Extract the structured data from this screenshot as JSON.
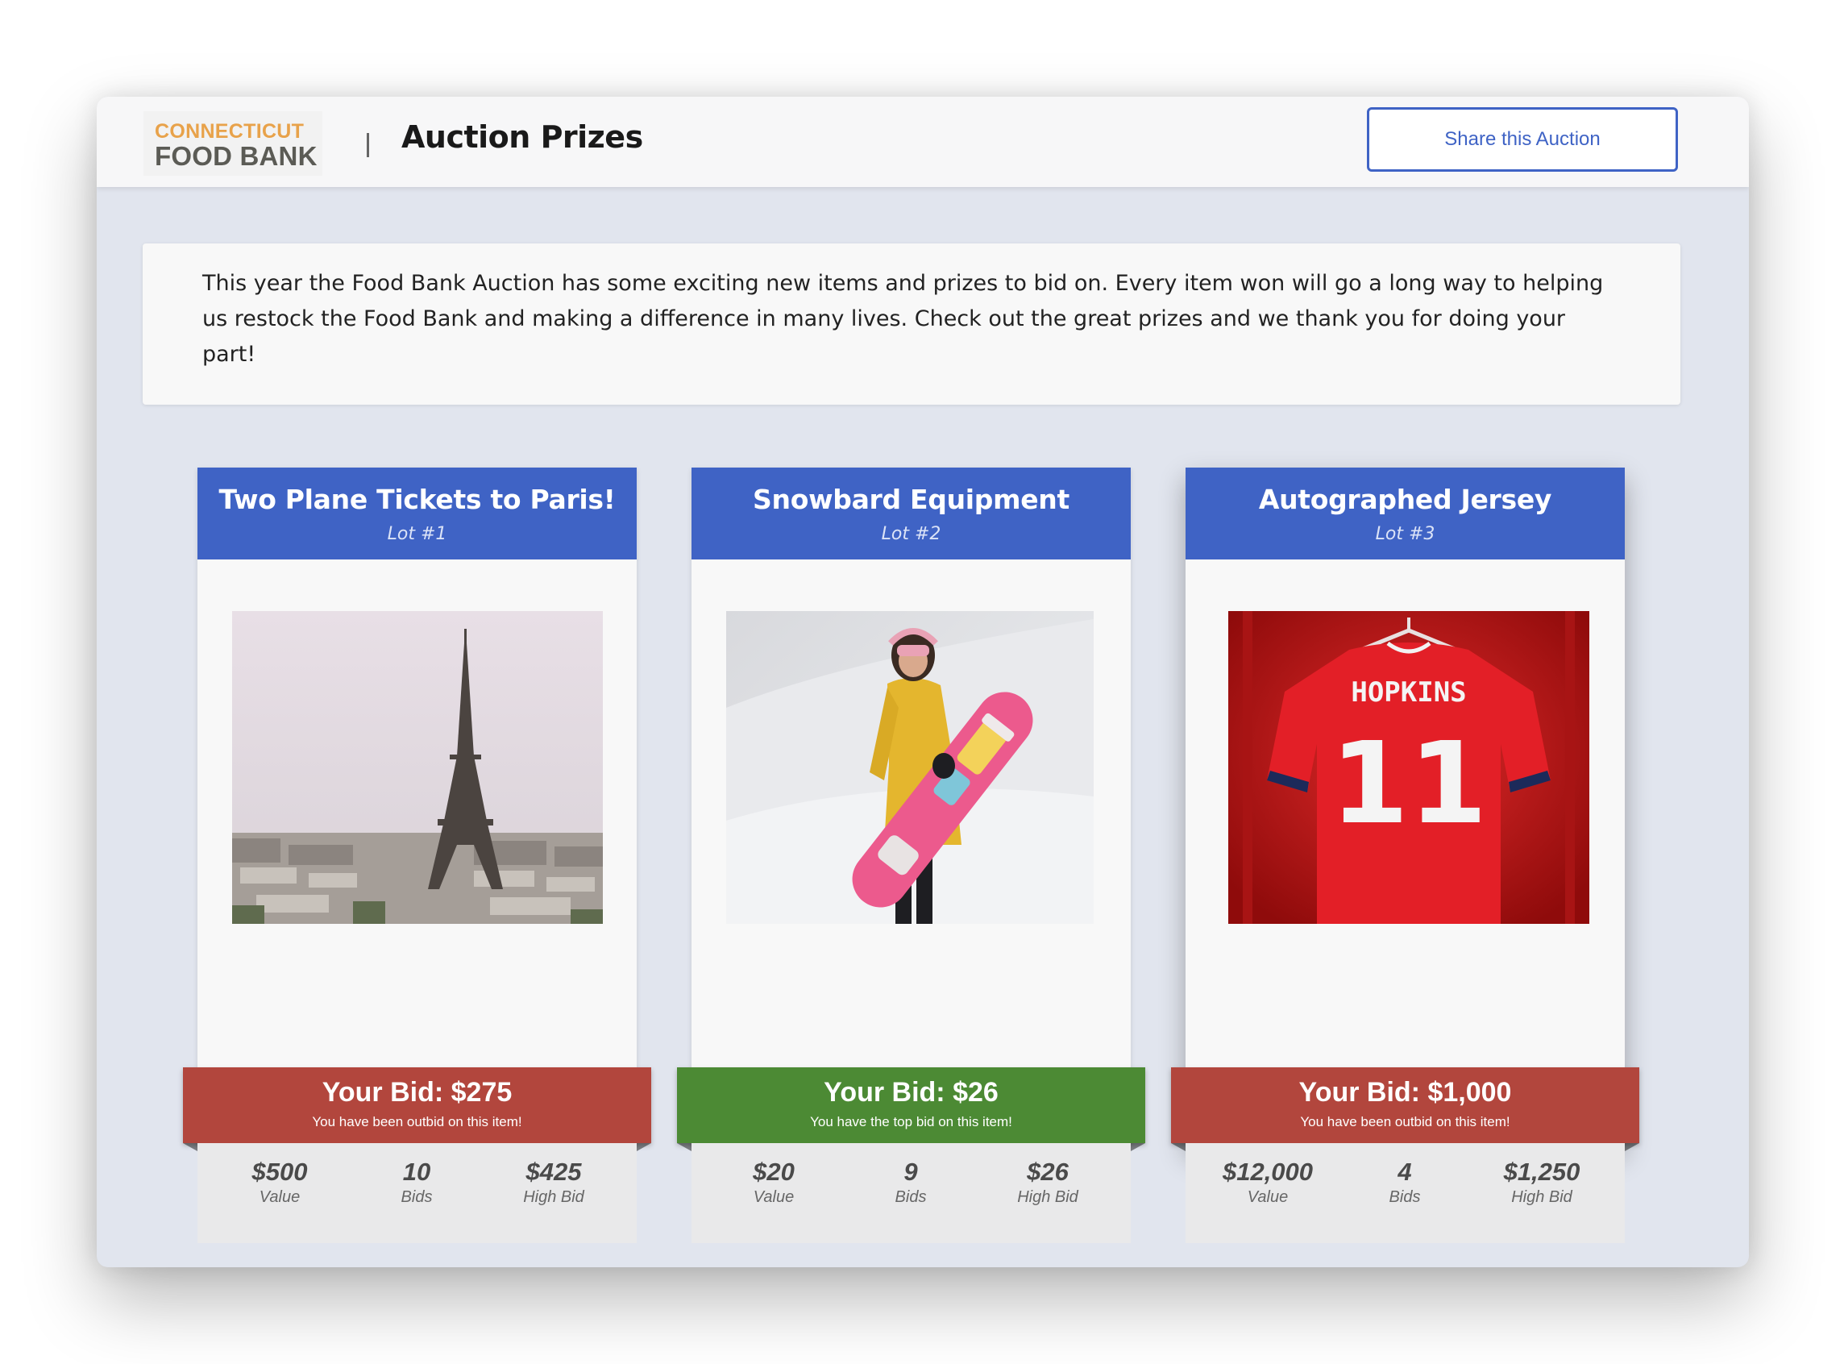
{
  "header": {
    "logo_line1": "CONNECTICUT",
    "logo_line2": "FOOD BANK",
    "title": "Auction Prizes",
    "share_label": "Share this Auction"
  },
  "intro": "This year the Food Bank Auction has some exciting new items and prizes to bid on. Every item won will go a long way to helping us restock the Food Bank and making a difference in many lives. Check out the great prizes and we thank you for doing your part!",
  "colors": {
    "brand_blue": "#3f63c5",
    "outbid_red": "#b2463d",
    "top_bid_green": "#4c8a34",
    "logo_orange": "#e8a24a"
  },
  "items": [
    {
      "title": "Two Plane Tickets to Paris!",
      "lot": "Lot #1",
      "image": "eiffel-tower-photo",
      "bid": "Your Bid: $275",
      "bid_status": "You have been outbid on this item!",
      "value": "$500",
      "value_label": "Value",
      "bids": "10",
      "bids_label": "Bids",
      "high_bid": "$425",
      "high_bid_label": "High Bid"
    },
    {
      "title": "Snowbard Equipment",
      "lot": "Lot #2",
      "image": "snowboarder-photo",
      "bid": "Your Bid: $26",
      "bid_status": "You have the top bid on this item!",
      "value": "$20",
      "value_label": "Value",
      "bids": "9",
      "bids_label": "Bids",
      "high_bid": "$26",
      "high_bid_label": "High Bid"
    },
    {
      "title": "Autographed Jersey",
      "lot": "Lot #3",
      "image": "red-jersey-photo",
      "jersey_name": "HOPKINS",
      "jersey_number": "11",
      "bid": "Your Bid: $1,000",
      "bid_status": "You have been outbid on this item!",
      "value": "$12,000",
      "value_label": "Value",
      "bids": "4",
      "bids_label": "Bids",
      "high_bid": "$1,250",
      "high_bid_label": "High Bid"
    }
  ]
}
